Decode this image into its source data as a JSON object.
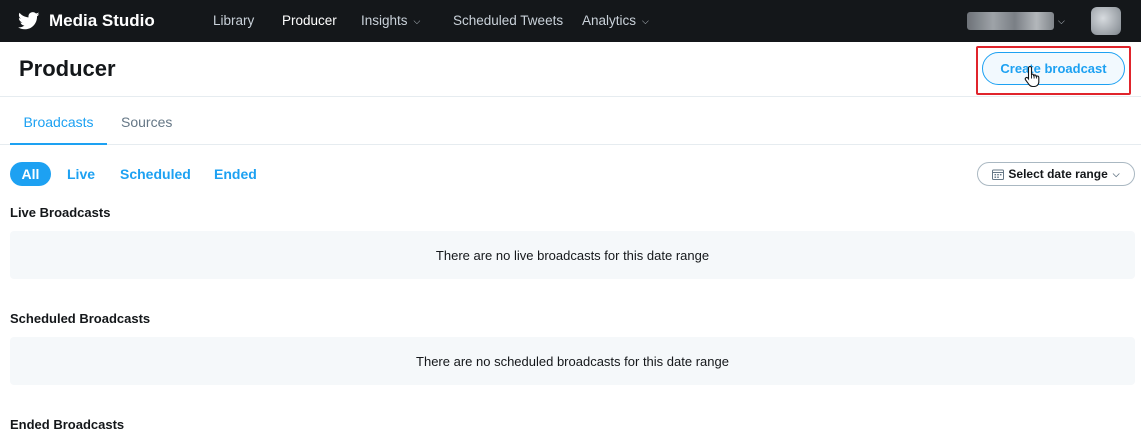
{
  "nav": {
    "brand": "Media Studio",
    "brand_icon": "twitter-bird-icon",
    "items": [
      {
        "label": "Library",
        "active": false
      },
      {
        "label": "Producer",
        "active": true
      },
      {
        "label": "Insights",
        "dropdown": true
      },
      {
        "label": "Scheduled Tweets",
        "active": false
      },
      {
        "label": "Analytics",
        "dropdown": true
      }
    ],
    "account_icon": "chevron-down-icon"
  },
  "header": {
    "title": "Producer",
    "create_button": "Create broadcast",
    "highlight_color": "#e0242c"
  },
  "tabs": [
    {
      "label": "Broadcasts",
      "active": true
    },
    {
      "label": "Sources",
      "active": false
    }
  ],
  "filters": {
    "items": [
      "All",
      "Live",
      "Scheduled",
      "Ended"
    ],
    "selected": "All",
    "date_range_label": "Select date range"
  },
  "sections": {
    "live": {
      "title": "Live Broadcasts",
      "empty": "There are no live broadcasts for this date range"
    },
    "scheduled": {
      "title": "Scheduled Broadcasts",
      "empty": "There are no scheduled broadcasts for this date range"
    },
    "ended": {
      "title": "Ended Broadcasts"
    }
  },
  "colors": {
    "accent": "#1da1f2",
    "nav_bg": "#14171a",
    "empty_bg": "#f5f8fa"
  }
}
